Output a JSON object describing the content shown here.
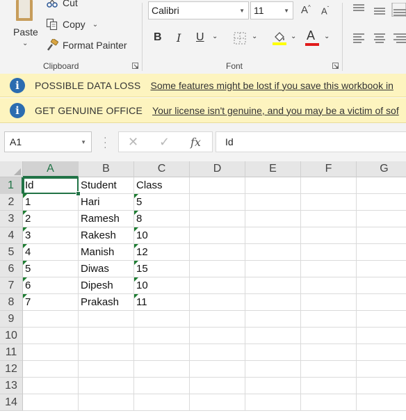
{
  "ribbon": {
    "clipboard": {
      "paste_label": "Paste",
      "cut_label": "Cut",
      "copy_label": "Copy",
      "format_painter_label": "Format Painter",
      "group_label": "Clipboard"
    },
    "font": {
      "font_name": "Calibri",
      "font_size": "11",
      "grow_label": "A",
      "shrink_label": "A",
      "bold_label": "B",
      "italic_label": "I",
      "underline_label": "U",
      "font_color_label": "A",
      "group_label": "Font",
      "highlight_color": "#ffff00",
      "font_color": "#e11b1b"
    }
  },
  "message_bars": [
    {
      "title": "POSSIBLE DATA LOSS",
      "message": "Some features might be lost if you save this workbook in"
    },
    {
      "title": "GET GENUINE OFFICE",
      "message": "Your license isn't genuine, and you may be a victim of sof"
    }
  ],
  "formula_bar": {
    "name_box": "A1",
    "fx_label": "fx",
    "formula": "Id"
  },
  "sheet": {
    "columns": [
      "A",
      "B",
      "C",
      "D",
      "E",
      "F",
      "G"
    ],
    "rows": [
      "1",
      "2",
      "3",
      "4",
      "5",
      "6",
      "7",
      "8",
      "9",
      "10",
      "11",
      "12",
      "13",
      "14"
    ],
    "cells": [
      [
        "Id",
        "Student",
        "Class"
      ],
      [
        "1",
        "Hari",
        "5"
      ],
      [
        "2",
        "Ramesh",
        "8"
      ],
      [
        "3",
        "Rakesh",
        "10"
      ],
      [
        "4",
        "Manish",
        "12"
      ],
      [
        "5",
        "Diwas",
        "15"
      ],
      [
        "6",
        "Dipesh",
        "10"
      ],
      [
        "7",
        "Prakash",
        "11"
      ]
    ],
    "selected_cell": "A1",
    "accent_color": "#217346",
    "warning_color": "#1e7d32"
  }
}
